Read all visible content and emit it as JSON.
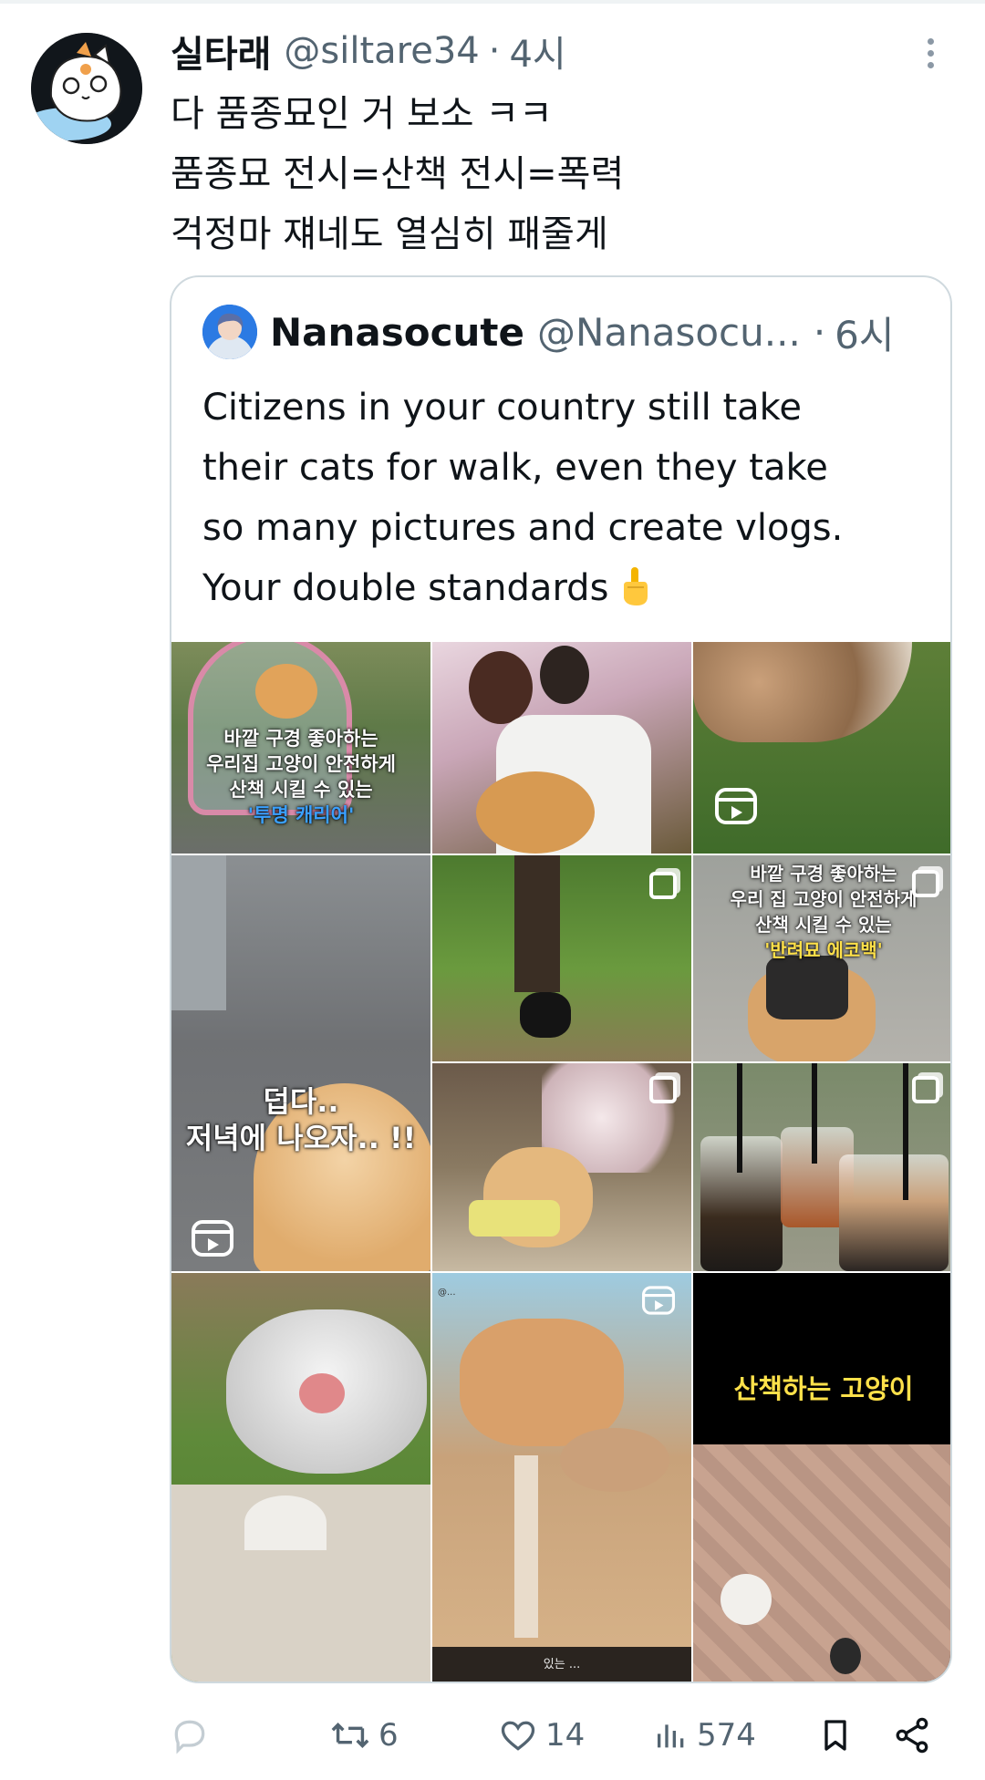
{
  "tweet": {
    "display_name": "실타래",
    "handle": "@siltare34",
    "separator": "·",
    "time": "4시",
    "body_lines": [
      "다 품종묘인 거 보소 ㅋㅋ",
      "품종묘 전시=산책 전시=폭력",
      "걱정마 쟤네도 열심히 패줄게"
    ],
    "more_icon": "more-vertical-icon",
    "avatar_icon": "cat-avatar"
  },
  "quote": {
    "display_name": "Nanasocute",
    "handle": "@Nanasocu...",
    "separator": "·",
    "time": "6시",
    "text_lines": [
      "Citizens in your country still take",
      "their cats for walk, even they take",
      "so many pictures and create vlogs.",
      "Your double standards"
    ],
    "emoji": "middle-finger-emoji",
    "grid_overlays": {
      "cell1": [
        "바깥 구경 좋아하는",
        "우리집 고양이 안전하게",
        "산책 시킬 수 있는",
        "'투명 캐리어'"
      ],
      "cell6": [
        "바깥 구경 좋아하는",
        "우리 집 고양이 안전하게",
        "산책 시킬 수 있는",
        "'반려묘 에코백'"
      ],
      "cell4": [
        "덥다..",
        "저녁에 나오자.. !!"
      ],
      "cell12": "산책하는 고양이",
      "cell11_caption": "있는 ...",
      "cell11_tag": "@..."
    }
  },
  "actions": {
    "reply_count": "",
    "retweet_count": "6",
    "like_count": "14",
    "views_count": "574"
  },
  "colors": {
    "text": "#0f1419",
    "secondary": "#536471",
    "border": "#cfd9de",
    "accent_blue": "#3aa0ff",
    "accent_yellow": "#ffe14a"
  }
}
